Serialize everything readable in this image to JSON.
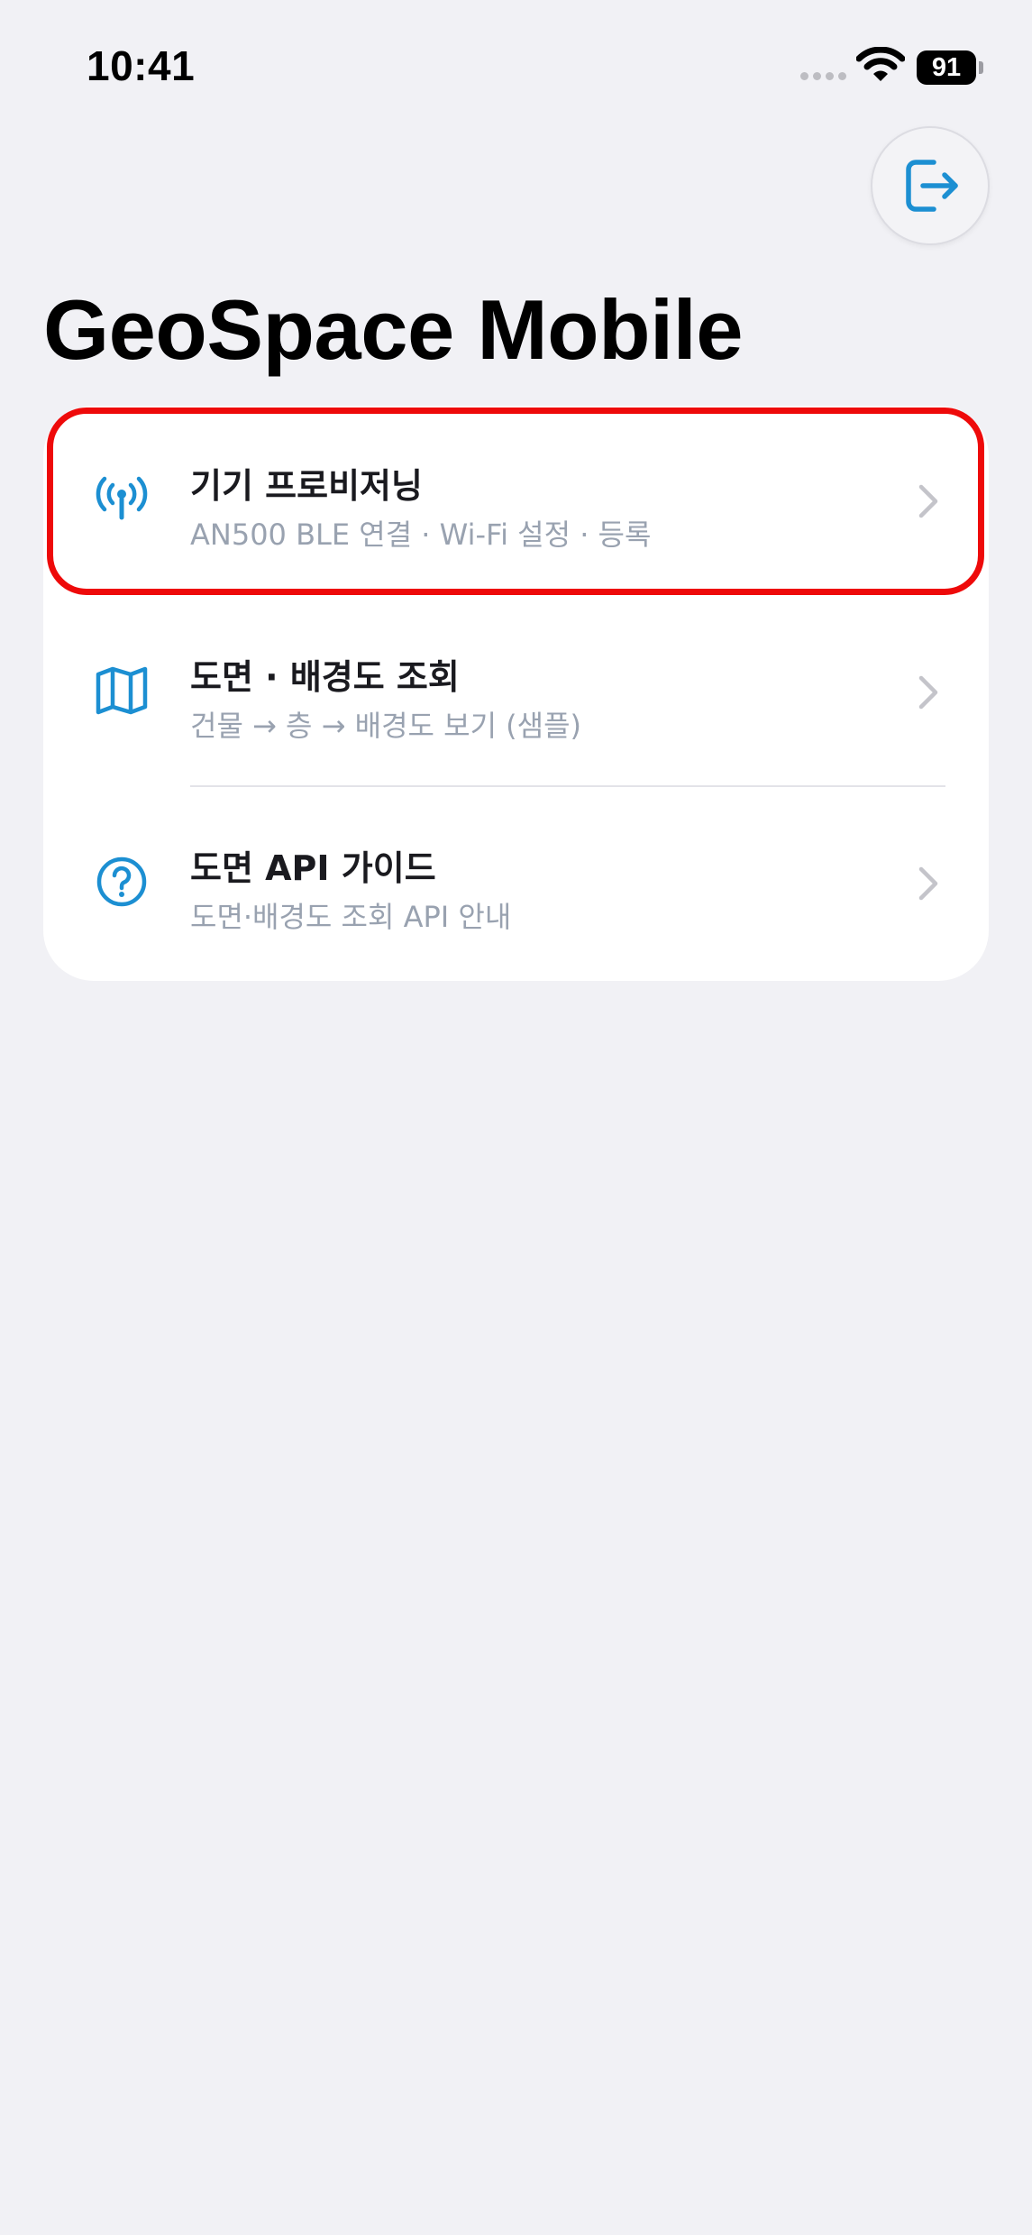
{
  "status_bar": {
    "time": "10:41",
    "battery_level": "91"
  },
  "header": {
    "logout_icon": "logout-icon"
  },
  "page": {
    "title": "GeoSpace Mobile"
  },
  "menu": {
    "items": [
      {
        "icon": "antenna-icon",
        "title": "기기 프로비저닝",
        "subtitle": "AN500 BLE 연결 · Wi-Fi 설정 · 등록"
      },
      {
        "icon": "map-icon",
        "title": "도면 · 배경도 조회",
        "subtitle": "건물 → 층 → 배경도 보기 (샘플)"
      },
      {
        "icon": "help-icon",
        "title": "도면 API 가이드",
        "subtitle": "도면·배경도 조회 API 안내"
      }
    ]
  },
  "colors": {
    "accent": "#1c8fd2",
    "background": "#f1f1f5",
    "highlight": "#ee0a0a",
    "subtitle": "#99a2b0"
  }
}
